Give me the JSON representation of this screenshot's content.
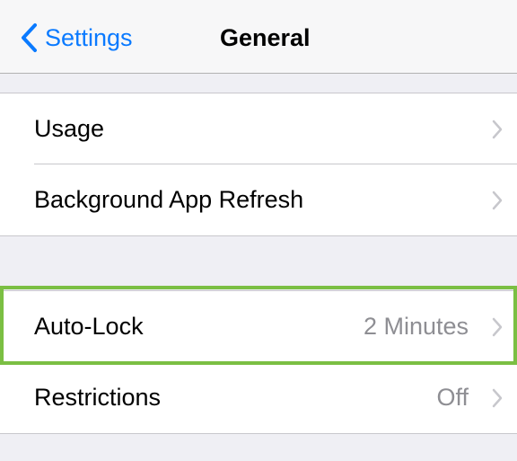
{
  "navbar": {
    "back_label": "Settings",
    "title": "General",
    "back_icon": "chevron-left-icon",
    "accent_color": "#0a7aff"
  },
  "groups": [
    {
      "rows": [
        {
          "label": "Usage",
          "value": ""
        },
        {
          "label": "Background App Refresh",
          "value": ""
        }
      ]
    },
    {
      "rows": [
        {
          "label": "Auto-Lock",
          "value": "2 Minutes",
          "highlighted": true
        },
        {
          "label": "Restrictions",
          "value": "Off"
        }
      ]
    }
  ],
  "colors": {
    "background": "#efeff4",
    "highlight": "#7bbf43",
    "secondary_text": "#8e8e93"
  }
}
